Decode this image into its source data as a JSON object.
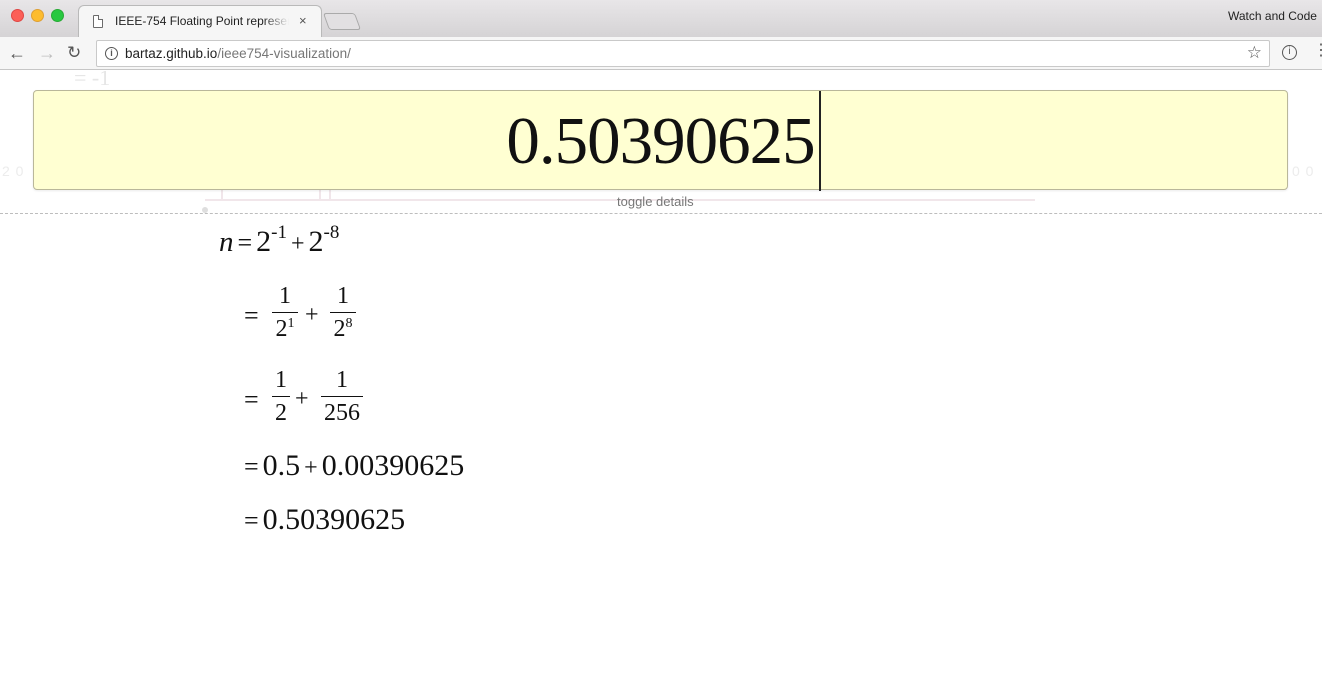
{
  "browser": {
    "tab_title": "IEEE-754 Floating Point representation",
    "tab_close": "×",
    "profile_text": "Watch and Code",
    "url_host": "bartaz.github.io",
    "url_path": "/ieee754-visualization/",
    "icons": [
      "back-arrow-icon",
      "forward-arrow-icon",
      "reload-icon",
      "info-icon",
      "star-icon",
      "extension-icon",
      "menu-icon",
      "page-icon",
      "close-icon"
    ]
  },
  "input": {
    "value": "0.50390625"
  },
  "toggle_label": "toggle details",
  "ghost": {
    "eq": "= -1",
    "left": "2 0",
    "right": "0 0"
  },
  "math": {
    "line1": {
      "n": "n",
      "eq": "=",
      "base1": "2",
      "exp1": "-1",
      "plus": "+",
      "base2": "2",
      "exp2": "-8"
    },
    "line2": {
      "eq": "=",
      "num1": "1",
      "den1_base": "2",
      "den1_exp": "1",
      "plus": "+",
      "num2": "1",
      "den2_base": "2",
      "den2_exp": "8"
    },
    "line3": {
      "eq": "=",
      "num1": "1",
      "den1": "2",
      "plus": "+",
      "num2": "1",
      "den2": "256"
    },
    "line4": {
      "eq": "=",
      "a": "0.5",
      "plus": "+",
      "b": "0.00390625"
    },
    "line5": {
      "eq": "=",
      "result": "0.50390625"
    }
  }
}
